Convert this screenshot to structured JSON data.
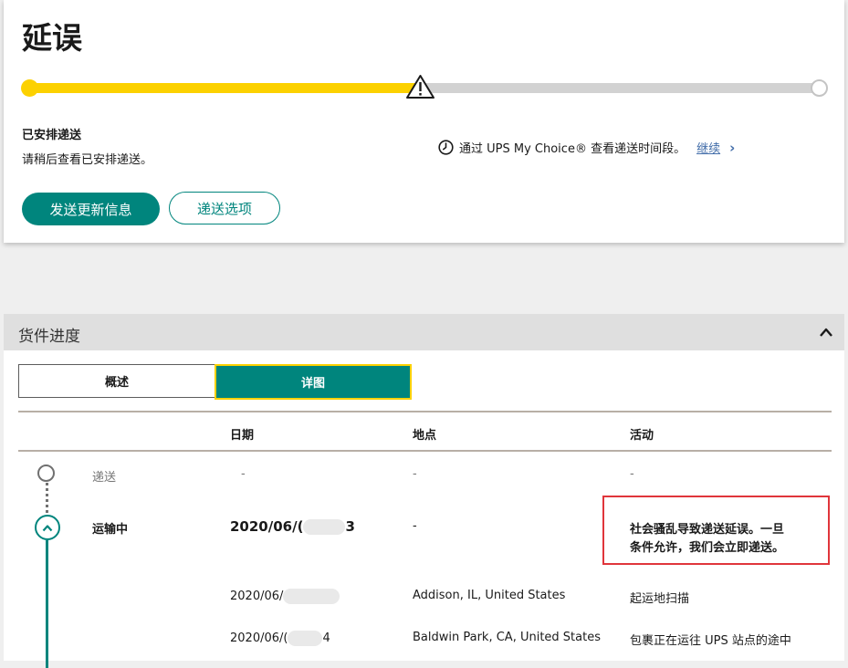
{
  "status": {
    "title": "延误",
    "progress_percent": 50,
    "scheduled_heading": "已安排递送",
    "scheduled_text": "请稍后查看已安排递送。",
    "mychoice_text": "通过 UPS My Choice® 查看递送时间段。",
    "continue_link": "继续",
    "primary_button": "发送更新信息",
    "secondary_button": "递送选项"
  },
  "progress_section": {
    "title": "货件进度",
    "tabs": {
      "overview": "概述",
      "detail": "详图"
    },
    "columns": {
      "date": "日期",
      "location": "地点",
      "activity": "活动"
    },
    "rows": [
      {
        "status": "递送",
        "date": "-",
        "location": "-",
        "activity": "-"
      },
      {
        "status": "运输中",
        "date": "2020/06/(",
        "date_tail": "3",
        "location": "-",
        "activity_line1": "社会骚乱导致递送延误。一旦",
        "activity_line2": "条件允许，我们会立即递送。"
      },
      {
        "date": "2020/06/",
        "location": "Addison, IL, United States",
        "activity": "起运地扫描"
      },
      {
        "date": "2020/06/(",
        "date_tail": "4",
        "location": "Baldwin Park, CA, United States",
        "activity": "包裹正在运往 UPS 站点的途中"
      }
    ]
  },
  "colors": {
    "brand_green": "#00857d",
    "progress_yellow": "#fcd100",
    "highlight_red": "#e0353b",
    "link_blue": "#426da9"
  }
}
